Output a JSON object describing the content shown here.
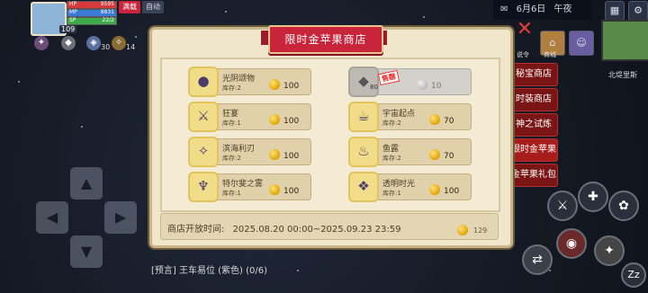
{
  "hud": {
    "level": "109",
    "hp_label": "HP",
    "hp_value": "9595",
    "mp_label": "MP",
    "mp_value": "8831",
    "sp_label": "SP",
    "sp_value": "22/2",
    "tag_a": "满载",
    "tag_b": "自动",
    "resource_values": [
      "30",
      "14"
    ],
    "date": "6月6日",
    "time_of_day": "午夜",
    "minimap_label": "北堤里斯",
    "bottom_message": "[预言] 王车易位 (紫色) (0/6)",
    "side_menu": [
      "秘宝商店",
      "时装商店",
      "神之试炼",
      "限时金苹果",
      "金苹果礼包"
    ],
    "top_icon_labels": [
      "说令",
      "商城"
    ]
  },
  "shop": {
    "title": "限时金苹果商店",
    "items": [
      {
        "name": "光阴颂物",
        "stock": "库存:2",
        "price": "100",
        "sold": false,
        "icon": "dark-orb-icon"
      },
      {
        "name": "",
        "stock": "80",
        "price": "10",
        "sold": true,
        "sold_label": "售罄",
        "icon": "gem-icon"
      },
      {
        "name": "狂宴",
        "stock": "库存:1",
        "price": "100",
        "sold": false,
        "icon": "sword-icon"
      },
      {
        "name": "宇宙起点",
        "stock": "库存:2",
        "price": "70",
        "sold": false,
        "icon": "teapot-icon"
      },
      {
        "name": "滨海利刃",
        "stock": "库存:2",
        "price": "100",
        "sold": false,
        "icon": "blade-icon"
      },
      {
        "name": "鱼露",
        "stock": "库存:2",
        "price": "70",
        "sold": false,
        "icon": "bottle-icon"
      },
      {
        "name": "特尔斐之雾",
        "stock": "库存:1",
        "price": "100",
        "sold": false,
        "icon": "goblet-icon"
      },
      {
        "name": "透明时光",
        "stock": "库存:1",
        "price": "100",
        "sold": false,
        "icon": "crystal-icon"
      }
    ],
    "footer_label": "商店开放时间:",
    "footer_period": "2025.08.20 00:00~2025.09.23 23:59",
    "currency_amount": "129"
  },
  "colors": {
    "banner": "#c8243a",
    "panel": "#efe6cc",
    "coin": "#e0a400",
    "side_menu": "#7a1515"
  }
}
